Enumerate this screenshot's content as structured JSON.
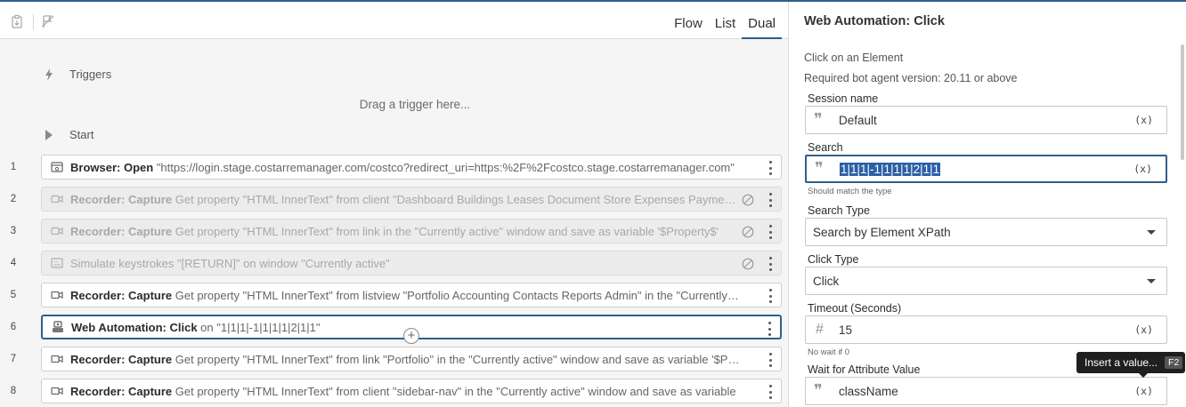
{
  "toolbar": {
    "icons": [
      "clipboard-icon",
      "flag-off-icon"
    ],
    "tabs": [
      {
        "label": "Flow",
        "active": false
      },
      {
        "label": "List",
        "active": false
      },
      {
        "label": "Dual",
        "active": true
      }
    ]
  },
  "flow": {
    "triggers_label": "Triggers",
    "drag_hint": "Drag a trigger here...",
    "start_label": "Start",
    "rows": [
      {
        "num": "1",
        "icon": "browser-icon",
        "bold": "Browser: Open",
        "rest": " \"https://login.stage.costarremanager.com/costco?redirect_uri=https:%2F%2Fcostco.stage.costarremanager.com\"",
        "disabled": false
      },
      {
        "num": "2",
        "icon": "recorder-icon",
        "bold": "Recorder: Capture",
        "rest": " Get property \"HTML InnerText\" from client \"Dashboard Buildings Leases Document Store Expenses Payments\"",
        "disabled": true
      },
      {
        "num": "3",
        "icon": "recorder-icon",
        "bold": "Recorder: Capture",
        "rest": " Get property \"HTML InnerText\" from link in the \"Currently active\" window and save as variable '$Property$'",
        "disabled": true
      },
      {
        "num": "4",
        "icon": "keystroke-icon",
        "bold": "",
        "rest": "Simulate keystrokes \"[RETURN]\" on window \"Currently active\"",
        "disabled": true
      },
      {
        "num": "5",
        "icon": "recorder-icon",
        "bold": "Recorder: Capture",
        "rest": " Get property \"HTML InnerText\" from listview \"Portfolio Accounting Contacts Reports Admin\" in the \"Currently active\" window",
        "disabled": false
      },
      {
        "num": "6",
        "icon": "web-automation-icon",
        "bold": "Web Automation: Click",
        "rest": " on \"1|1|1|-1|1|1|1|2|1|1\"",
        "disabled": false,
        "selected": true
      },
      {
        "num": "7",
        "icon": "recorder-icon",
        "bold": "Recorder: Capture",
        "rest": " Get property \"HTML InnerText\" from link \"Portfolio\" in the \"Currently active\" window and save as variable '$Portfolio$'",
        "disabled": false
      },
      {
        "num": "8",
        "icon": "recorder-icon",
        "bold": "Recorder: Capture",
        "rest": " Get property \"HTML InnerText\" from client \"sidebar-nav\" in the \"Currently active\" window and save as variable",
        "disabled": false
      }
    ]
  },
  "panel": {
    "title": "Web Automation: Click",
    "subtitle": "Click on an Element",
    "version_note": "Required bot agent version: 20.11 or above",
    "session": {
      "label": "Session name",
      "value": "Default",
      "var_button": "(x)"
    },
    "search": {
      "label": "Search",
      "value": "1|1|1|-1|1|1|1|2|1|1",
      "var_button": "(x)",
      "hint": "Should match the type"
    },
    "search_type": {
      "label": "Search Type",
      "value": "Search by Element XPath"
    },
    "click_type": {
      "label": "Click Type",
      "value": "Click"
    },
    "timeout": {
      "label": "Timeout (Seconds)",
      "value": "15",
      "var_button": "(x)",
      "hint": "No wait if 0"
    },
    "wait_attr": {
      "label": "Wait for Attribute Value",
      "value": "className",
      "var_button": "(x)"
    },
    "tooltip": {
      "text": "Insert a value...",
      "key": "F2"
    }
  },
  "colors": {
    "accent": "#2f5f8a",
    "selection": "#2b5fa6",
    "tooltip_bg": "#1f1f1f"
  }
}
